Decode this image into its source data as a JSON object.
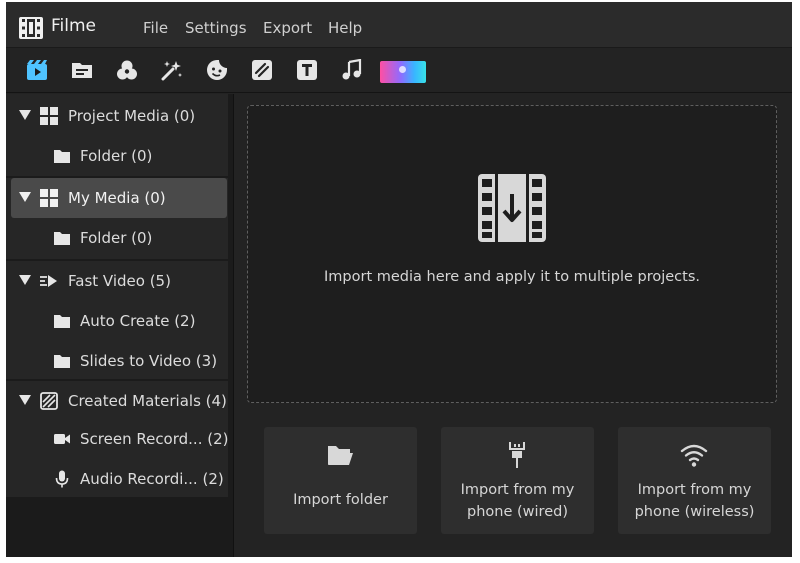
{
  "app": {
    "name": "Filme",
    "accent": "#4fc3ff"
  },
  "menu": [
    "File",
    "Settings",
    "Export",
    "Help"
  ],
  "toolbar": {
    "icons": [
      "media-icon",
      "folder-icon",
      "effects-icon",
      "magic-icon",
      "sticker-icon",
      "transition-icon",
      "text-icon",
      "music-icon",
      "color-gradient-icon"
    ],
    "active": "media-icon"
  },
  "sidebar": {
    "project_media": "Project Media (0)",
    "project_folder": "Folder (0)",
    "my_media": "My Media (0)",
    "my_folder": "Folder (0)",
    "fast_video": "Fast Video (5)",
    "auto_create": "Auto Create (2)",
    "slides_to_video": "Slides to Video (3)",
    "created_materials": "Created Materials (4)",
    "screen_record": "Screen Record... (2)",
    "audio_record": "Audio Recordi... (2)",
    "selected": "My Media (0)"
  },
  "main": {
    "drop_text": "Import media here and apply it to multiple projects.",
    "import_folder": "Import folder",
    "import_wired_1": "Import from my",
    "import_wired_2": "phone (wired)",
    "import_wireless_1": "Import from my",
    "import_wireless_2": "phone (wireless)"
  }
}
